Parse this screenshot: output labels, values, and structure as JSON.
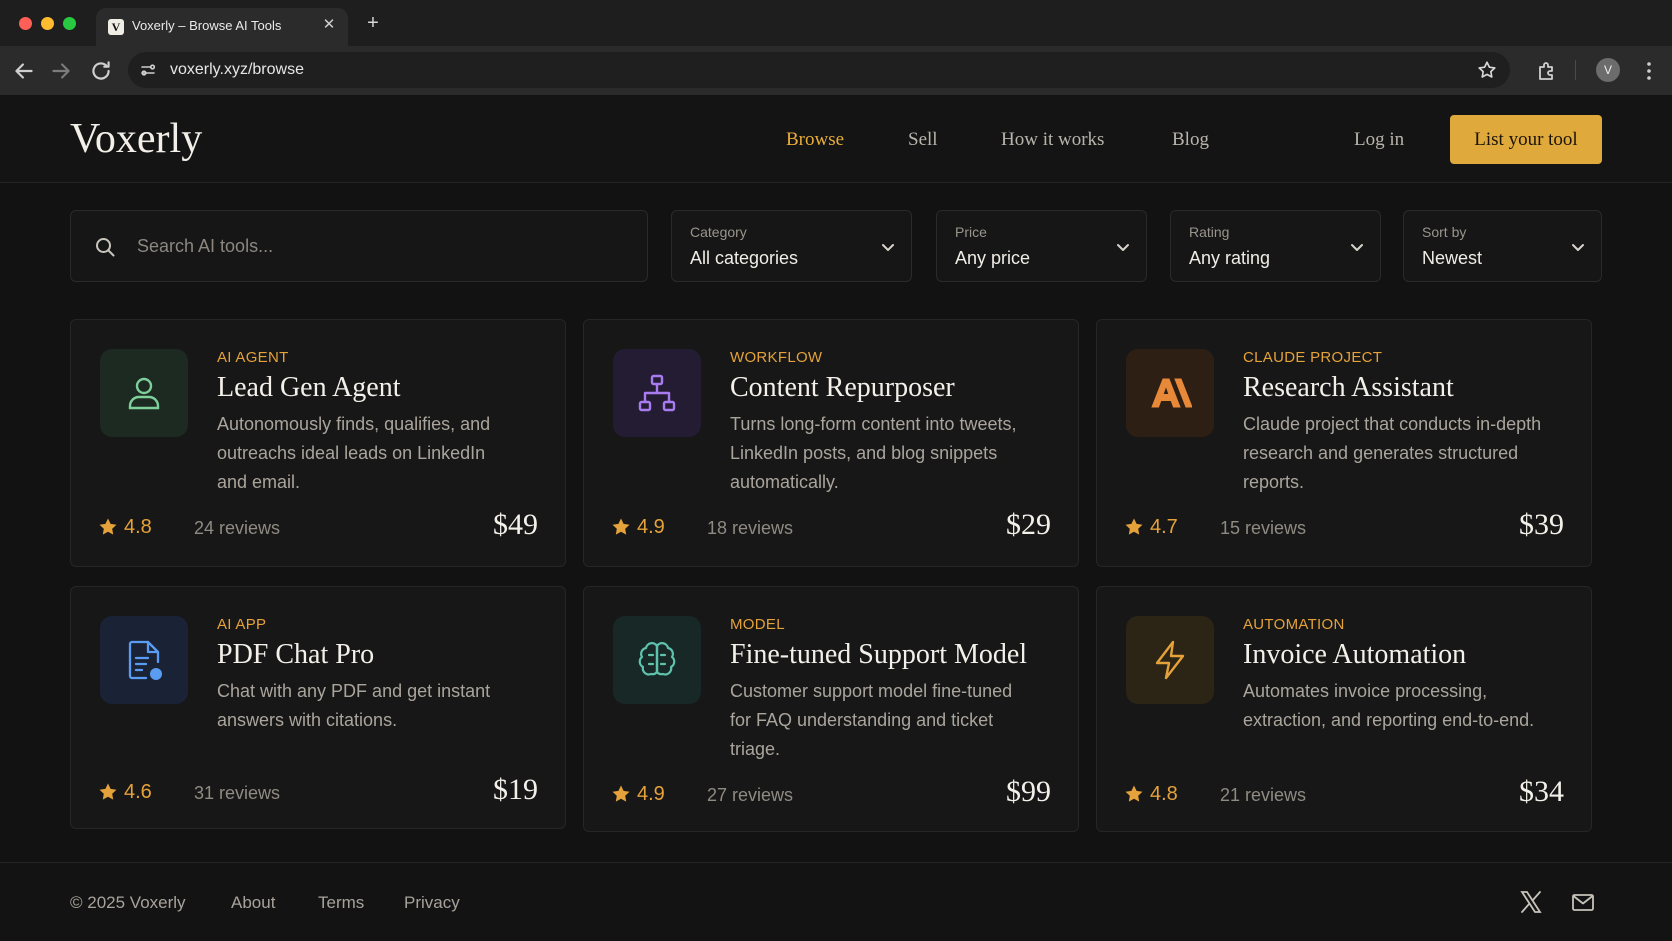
{
  "browser": {
    "tab_title": "Voxerly – Browse AI Tools",
    "favicon_letter": "V",
    "close_glyph": "✕",
    "new_tab_glyph": "+",
    "url": "voxerly.xyz/browse",
    "profile_initial": "V"
  },
  "header": {
    "logo": "Voxerly",
    "nav": [
      "Browse",
      "Sell",
      "How it works",
      "Blog"
    ],
    "active_nav": "Browse",
    "login": "Log in",
    "cta": "List your tool"
  },
  "filters": {
    "search_placeholder": "Search AI tools...",
    "category": {
      "label": "Category",
      "value": "All categories"
    },
    "price": {
      "label": "Price",
      "value": "Any price"
    },
    "rating": {
      "label": "Rating",
      "value": "Any rating"
    },
    "sort": {
      "label": "Sort by",
      "value": "Newest"
    }
  },
  "tools": [
    {
      "category": "AI AGENT",
      "title": "Lead Gen Agent",
      "description": "Autonomously finds, qualifies, and outreachs ideal leads on LinkedIn and email.",
      "rating": "4.8",
      "reviews": "24 reviews",
      "price": "$49",
      "icon": "user-icon",
      "accent": "#7fcf9a",
      "icon_bg": "#1c2a22"
    },
    {
      "category": "WORKFLOW",
      "title": "Content Repurposer",
      "description": "Turns long-form content into tweets, LinkedIn posts, and blog snippets automatically.",
      "rating": "4.9",
      "reviews": "18 reviews",
      "price": "$29",
      "icon": "hierarchy-icon",
      "accent": "#a87cf0",
      "icon_bg": "#231c33"
    },
    {
      "category": "CLAUDE PROJECT",
      "title": "Research Assistant",
      "description": "Claude project that conducts in-depth research and generates structured reports.",
      "rating": "4.7",
      "reviews": "15 reviews",
      "price": "$39",
      "icon": "anthropic-icon",
      "accent": "#e8893a",
      "icon_bg": "#2e1f14"
    },
    {
      "category": "AI APP",
      "title": "PDF Chat Pro",
      "description": "Chat with any PDF and get instant answers with citations.",
      "rating": "4.6",
      "reviews": "31 reviews",
      "price": "$19",
      "icon": "document-chat-icon",
      "accent": "#5a9cf2",
      "icon_bg": "#1a2236"
    },
    {
      "category": "MODEL",
      "title": "Fine-tuned Support Model",
      "description": "Customer support model fine-tuned for FAQ understanding and ticket triage.",
      "rating": "4.9",
      "reviews": "27 reviews",
      "price": "$99",
      "icon": "brain-icon",
      "accent": "#5ec2ac",
      "icon_bg": "#172826"
    },
    {
      "category": "AUTOMATION",
      "title": "Invoice Automation",
      "description": "Automates invoice processing, extraction, and reporting end-to-end.",
      "rating": "4.8",
      "reviews": "21 reviews",
      "price": "$34",
      "icon": "lightning-icon",
      "accent": "#e5a23a",
      "icon_bg": "#2c2414"
    }
  ],
  "footer": {
    "copyright": "© 2025 Voxerly",
    "links": [
      "About",
      "Terms",
      "Privacy"
    ]
  },
  "colors": {
    "accent": "#e5a23a",
    "cta_bg": "#e0a93b",
    "page_bg": "#121212"
  }
}
